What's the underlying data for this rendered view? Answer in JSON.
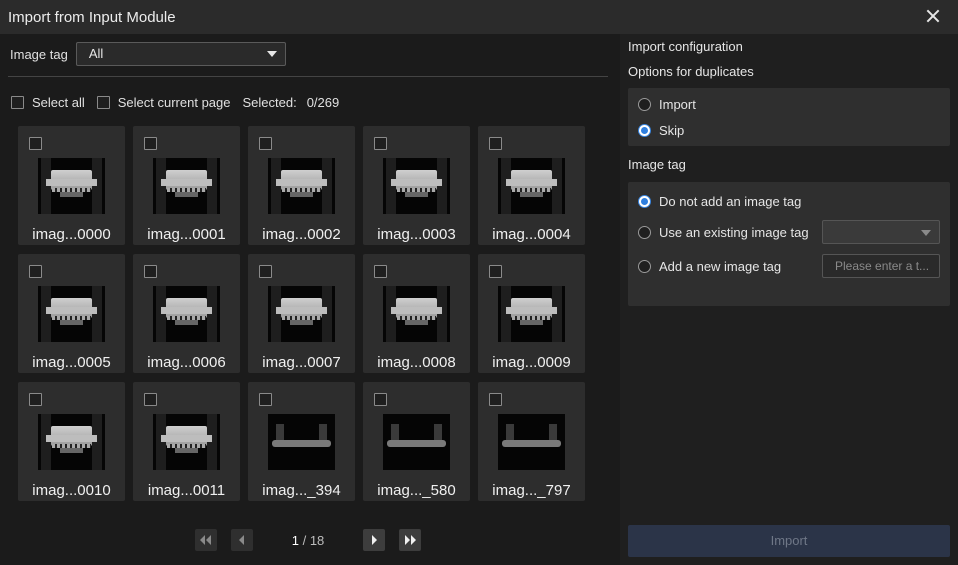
{
  "window": {
    "title": "Import from Input Module"
  },
  "filter": {
    "label": "Image tag",
    "value": "All"
  },
  "selection": {
    "select_all": "Select all",
    "select_page": "Select current page",
    "selected_label": "Selected:",
    "selected_count": "0/269"
  },
  "images": [
    {
      "name": "imag...0000",
      "thumb": "part"
    },
    {
      "name": "imag...0001",
      "thumb": "part"
    },
    {
      "name": "imag...0002",
      "thumb": "part"
    },
    {
      "name": "imag...0003",
      "thumb": "part"
    },
    {
      "name": "imag...0004",
      "thumb": "part"
    },
    {
      "name": "imag...0005",
      "thumb": "part"
    },
    {
      "name": "imag...0006",
      "thumb": "part"
    },
    {
      "name": "imag...0007",
      "thumb": "part"
    },
    {
      "name": "imag...0008",
      "thumb": "part"
    },
    {
      "name": "imag...0009",
      "thumb": "part"
    },
    {
      "name": "imag...0010",
      "thumb": "part"
    },
    {
      "name": "imag...0011",
      "thumb": "part"
    },
    {
      "name": "imag..._394",
      "thumb": "bracket"
    },
    {
      "name": "imag..._580",
      "thumb": "bracket"
    },
    {
      "name": "imag..._797",
      "thumb": "bracket"
    }
  ],
  "pagination": {
    "current": "1",
    "separator": "/",
    "total": "18"
  },
  "config": {
    "heading": "Import configuration",
    "duplicates_label": "Options for duplicates",
    "duplicates_options": [
      {
        "label": "Import",
        "checked": false
      },
      {
        "label": "Skip",
        "checked": true
      }
    ],
    "tag_label": "Image tag",
    "tag_options": [
      {
        "label": "Do not add an image tag",
        "checked": true
      },
      {
        "label": "Use an existing image tag",
        "checked": false
      },
      {
        "label": "Add a new image tag",
        "checked": false
      }
    ],
    "new_tag_placeholder": "Please enter a t...",
    "import_button": "Import"
  },
  "colors": {
    "accent": "#2f7fdf",
    "import_button_bg": "#2b3448"
  }
}
